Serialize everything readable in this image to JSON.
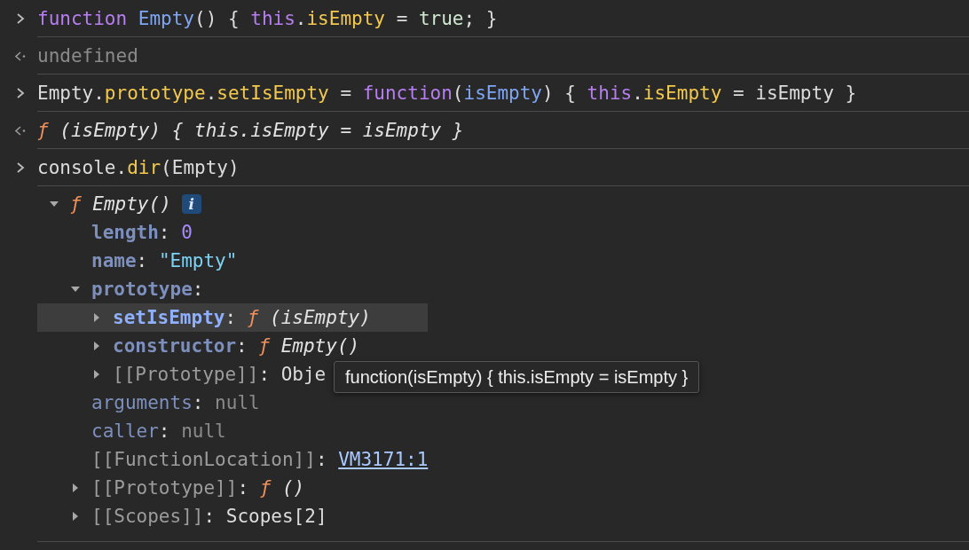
{
  "console": [
    {
      "kind": "input",
      "tokens": [
        {
          "text": "function",
          "kind": "keyword"
        },
        {
          "text": " Empty",
          "kind": "name"
        },
        {
          "text": "() { ",
          "kind": "plain"
        },
        {
          "text": "this",
          "kind": "keyword"
        },
        {
          "text": ".",
          "kind": "plain"
        },
        {
          "text": "isEmpty",
          "kind": "prop"
        },
        {
          "text": " = ",
          "kind": "plain"
        },
        {
          "text": "true",
          "kind": "literal"
        },
        {
          "text": "; }",
          "kind": "plain"
        }
      ]
    },
    {
      "kind": "result",
      "tokens": [
        {
          "text": "undefined",
          "kind": "muted"
        }
      ]
    },
    {
      "kind": "input",
      "tokens": [
        {
          "text": "Empty.",
          "kind": "plain"
        },
        {
          "text": "prototype",
          "kind": "prop"
        },
        {
          "text": ".",
          "kind": "plain"
        },
        {
          "text": "setIsEmpty",
          "kind": "prop"
        },
        {
          "text": " = ",
          "kind": "plain"
        },
        {
          "text": "function",
          "kind": "keyword"
        },
        {
          "text": "(",
          "kind": "plain"
        },
        {
          "text": "isEmpty",
          "kind": "name"
        },
        {
          "text": ") { ",
          "kind": "plain"
        },
        {
          "text": "this",
          "kind": "keyword"
        },
        {
          "text": ".",
          "kind": "plain"
        },
        {
          "text": "isEmpty",
          "kind": "prop"
        },
        {
          "text": " = isEmpty }",
          "kind": "plain"
        }
      ]
    },
    {
      "kind": "result",
      "tokens": [
        {
          "text": "ƒ",
          "kind": "fn"
        },
        {
          "text": " (isEmpty) { this.isEmpty = isEmpty }",
          "kind": "italic"
        }
      ]
    },
    {
      "kind": "input",
      "tokens": [
        {
          "text": "console.",
          "kind": "plain"
        },
        {
          "text": "dir",
          "kind": "prop"
        },
        {
          "text": "(Empty)",
          "kind": "plain"
        }
      ]
    },
    {
      "kind": "object",
      "tree": {
        "expanded": true,
        "selected": false,
        "value": [
          {
            "text": "ƒ",
            "kind": "fn"
          },
          {
            "text": " Empty()",
            "kind": "italic"
          }
        ],
        "badge": "i",
        "children": [
          {
            "key": {
              "text": "length",
              "kind": "own"
            },
            "selected": false,
            "value": [
              {
                "text": ":",
                "kind": "plain"
              },
              {
                "text": " 0",
                "kind": "number"
              }
            ]
          },
          {
            "key": {
              "text": "name",
              "kind": "own"
            },
            "selected": false,
            "value": [
              {
                "text": ":",
                "kind": "plain"
              },
              {
                "text": " \"Empty\"",
                "kind": "string"
              }
            ]
          },
          {
            "key": {
              "text": "prototype",
              "kind": "own"
            },
            "expanded": true,
            "selected": false,
            "value": [
              {
                "text": ":",
                "kind": "plain"
              }
            ],
            "children": [
              {
                "key": {
                  "text": "setIsEmpty",
                  "kind": "enumerable"
                },
                "expanded": false,
                "selected": true,
                "value": [
                  {
                    "text": ":",
                    "kind": "plain"
                  },
                  {
                    "text": " ƒ",
                    "kind": "fn"
                  },
                  {
                    "text": " (isEmpty)",
                    "kind": "italic"
                  }
                ]
              },
              {
                "key": {
                  "text": "constructor",
                  "kind": "own"
                },
                "expanded": false,
                "selected": false,
                "value": [
                  {
                    "text": ":",
                    "kind": "plain"
                  },
                  {
                    "text": " ƒ",
                    "kind": "fn"
                  },
                  {
                    "text": " Empty()",
                    "kind": "italic"
                  }
                ]
              },
              {
                "key": {
                  "text": "[[Prototype]]",
                  "kind": "internal"
                },
                "expanded": false,
                "selected": false,
                "value": [
                  {
                    "text": ":",
                    "kind": "plain"
                  },
                  {
                    "text": " Obje",
                    "kind": "plain"
                  }
                ]
              }
            ]
          },
          {
            "key": {
              "text": "arguments",
              "kind": "plain"
            },
            "selected": false,
            "value": [
              {
                "text": ":",
                "kind": "plain"
              },
              {
                "text": " null",
                "kind": "muted"
              }
            ]
          },
          {
            "key": {
              "text": "caller",
              "kind": "plain"
            },
            "selected": false,
            "value": [
              {
                "text": ":",
                "kind": "plain"
              },
              {
                "text": " null",
                "kind": "muted"
              }
            ]
          },
          {
            "key": {
              "text": "[[FunctionLocation]]",
              "kind": "internal"
            },
            "selected": false,
            "value": [
              {
                "text": ": ",
                "kind": "plain"
              },
              {
                "text": "VM3171:1",
                "kind": "link"
              }
            ]
          },
          {
            "key": {
              "text": "[[Prototype]]",
              "kind": "internal"
            },
            "expanded": false,
            "selected": false,
            "value": [
              {
                "text": ":",
                "kind": "plain"
              },
              {
                "text": " ƒ",
                "kind": "fn"
              },
              {
                "text": " ()",
                "kind": "italic"
              }
            ]
          },
          {
            "key": {
              "text": "[[Scopes]]",
              "kind": "internal"
            },
            "expanded": false,
            "selected": false,
            "value": [
              {
                "text": ":",
                "kind": "plain"
              },
              {
                "text": " Scopes[2]",
                "kind": "plain"
              }
            ]
          }
        ]
      }
    }
  ],
  "tooltip": "function(isEmpty) { this.isEmpty = isEmpty }"
}
